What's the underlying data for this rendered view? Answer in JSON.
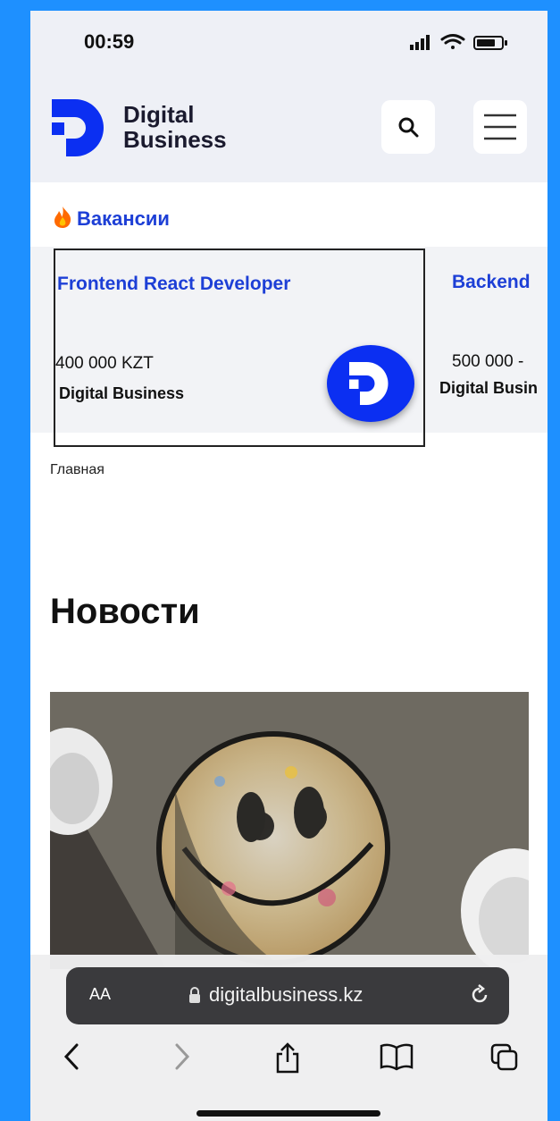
{
  "status": {
    "time": "00:59"
  },
  "header": {
    "brand_line1": "Digital",
    "brand_line2": "Business"
  },
  "vacancies": {
    "title": "Вакансии",
    "jobs": [
      {
        "title": "Frontend React Developer",
        "salary": "400 000 KZT",
        "company": "Digital Business"
      },
      {
        "title": "Backend",
        "salary": "500 000 -",
        "company": "Digital Busin"
      }
    ]
  },
  "breadcrumb": "Главная",
  "news": {
    "title": "Новости"
  },
  "browser": {
    "aa_label": "AA",
    "url": "digitalbusiness.kz"
  },
  "colors": {
    "accent": "#1d3fd6",
    "logo_blue": "#0b2ff2",
    "page_bg": "#1e90ff"
  }
}
